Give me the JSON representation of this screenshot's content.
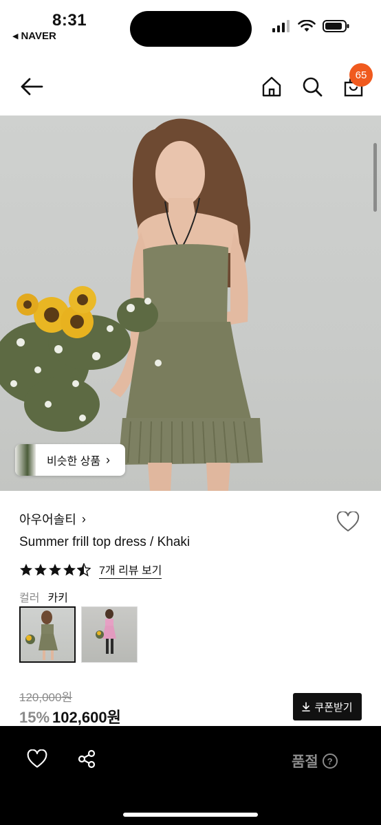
{
  "status": {
    "time": "8:31",
    "back_app": "NAVER"
  },
  "nav": {
    "cart_badge": "65"
  },
  "hero": {
    "similar_button_label": "비슷한 상품"
  },
  "product": {
    "brand": "아우어솔티",
    "name": "Summer frill top dress / Khaki",
    "rating_stars": 4.5,
    "review_link": "7개 리뷰 보기",
    "color_label": "컬러",
    "color_value": "카키",
    "original_price": "120,000원",
    "discount": "15%",
    "price": "102,600원",
    "coupon_button": "쿠폰받기"
  },
  "bottom_bar": {
    "status": "품절",
    "help": "?"
  },
  "colors": {
    "accent_badge": "#f05a1e",
    "bottom_bar": "#000000",
    "muted": "#8a8a8a",
    "dress_khaki": "#7f8262"
  }
}
